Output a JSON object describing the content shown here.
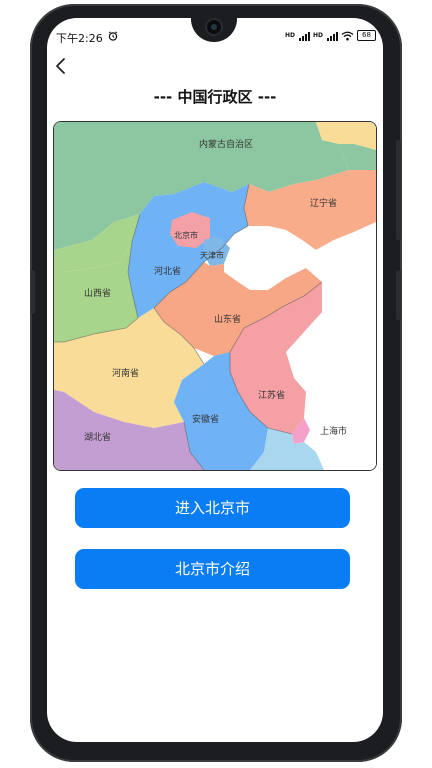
{
  "status_bar": {
    "time": "下午2:26",
    "battery": "68"
  },
  "page": {
    "title": "--- 中国行政区 ---"
  },
  "map": {
    "labels": {
      "neimenggu": "内蒙古自治区",
      "liaoning": "辽宁省",
      "beijing": "北京市",
      "tianjin": "天津市",
      "hebei": "河北省",
      "shanxi": "山西省",
      "shandong": "山东省",
      "henan": "河南省",
      "jiangsu": "江苏省",
      "anhui": "安徽省",
      "hubei": "湖北省",
      "shanghai": "上海市"
    },
    "colors": {
      "neimenggu": "#8cc7a1",
      "liaoning": "#f9ac8a",
      "hebei": "#6fb2f5",
      "beijing": "#f3a0a7",
      "tianjin": "#7fb7e6",
      "shanxi": "#a8d58c",
      "shandong": "#f7a785",
      "henan": "#f9dc98",
      "jiangsu": "#f4a0a5",
      "anhui": "#6fb2f5",
      "hubei": "#c39ed3",
      "sea": "#ffffff"
    }
  },
  "buttons": {
    "enter_label": "进入北京市",
    "intro_label": "北京市介绍"
  }
}
